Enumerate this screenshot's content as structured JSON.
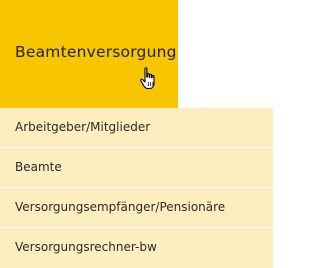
{
  "nav": {
    "active_tab": {
      "label": "Beamtenversorgung"
    },
    "submenu": {
      "items": [
        {
          "label": "Arbeitgeber/Mitglieder"
        },
        {
          "label": "Beamte"
        },
        {
          "label": "Versorgungsempfänger/Pensionäre"
        },
        {
          "label": "Versorgungsrechner-bw"
        }
      ]
    }
  },
  "colors": {
    "active_tab_bg": "#f7c600",
    "submenu_bg": "#fdeec0",
    "divider": "#ffffff"
  },
  "icons": {
    "cursor": "hand-pointer-icon"
  }
}
